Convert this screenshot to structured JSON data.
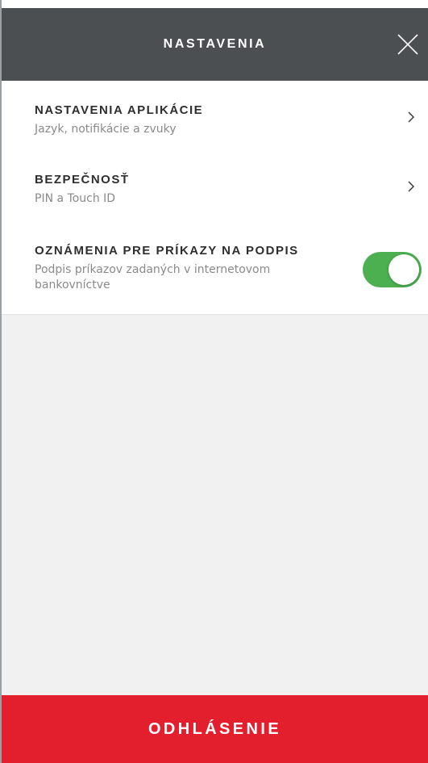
{
  "header": {
    "title": "NASTAVENIA",
    "close_icon": "close-icon"
  },
  "settings": {
    "items": [
      {
        "title": "NASTAVENIA APLIKÁCIE",
        "subtitle": "Jazyk, notifikácie a zvuky",
        "icon": "chevron-right-icon"
      },
      {
        "title": "BEZPEČNOSŤ",
        "subtitle": "PIN a Touch ID",
        "icon": "chevron-right-icon"
      },
      {
        "title": "OZNÁMENIA PRE PRÍKAZY NA PODPIS",
        "subtitle": "Podpis príkazov zadaných v internetovom bankovníctve",
        "toggle_on": true
      }
    ]
  },
  "footer": {
    "logout_label": "ODHLÁSENIE"
  },
  "colors": {
    "header_bg": "#4b4f52",
    "toggle_on": "#4caf50",
    "logout_bg": "#e31e2d",
    "content_bg": "#f1f1f1"
  }
}
